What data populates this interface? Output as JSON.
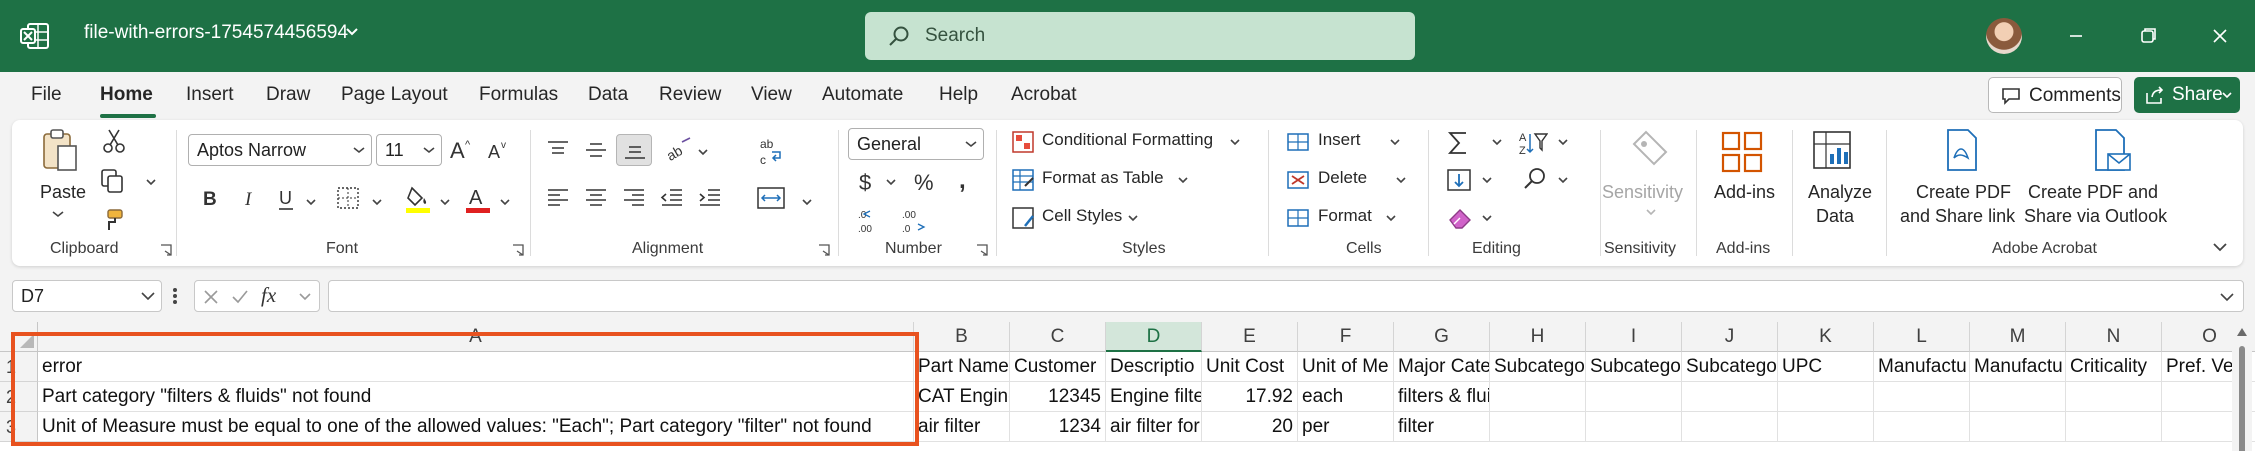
{
  "titlebar": {
    "file_name": "file-with-errors-1754574456594",
    "search_placeholder": "Search",
    "brand_color": "#1e7145"
  },
  "menu": {
    "tabs": [
      "File",
      "Home",
      "Insert",
      "Draw",
      "Page Layout",
      "Formulas",
      "Data",
      "Review",
      "View",
      "Automate",
      "Help",
      "Acrobat"
    ],
    "active_tab": "Home",
    "comments_label": "Comments",
    "share_label": "Share"
  },
  "ribbon": {
    "clipboard": {
      "label": "Clipboard",
      "paste": "Paste"
    },
    "font": {
      "label": "Font",
      "name": "Aptos Narrow",
      "size": "11"
    },
    "alignment": {
      "label": "Alignment"
    },
    "number": {
      "label": "Number",
      "format": "General"
    },
    "styles": {
      "label": "Styles",
      "conditional": "Conditional Formatting",
      "format_table": "Format as Table",
      "cell_styles": "Cell Styles"
    },
    "cells": {
      "label": "Cells",
      "insert": "Insert",
      "delete": "Delete",
      "format": "Format"
    },
    "editing": {
      "label": "Editing"
    },
    "sensitivity": {
      "label": "Sensitivity",
      "button": "Sensitivity"
    },
    "addins": {
      "label": "Add-ins",
      "button": "Add-ins"
    },
    "analyze": {
      "line1": "Analyze",
      "line2": "Data"
    },
    "acrobat": {
      "label": "Adobe Acrobat",
      "create_pdf_1": "Create PDF",
      "create_pdf_2": "and Share link",
      "create_outlook_1": "Create PDF and",
      "create_outlook_2": "Share via Outlook"
    }
  },
  "formula_bar": {
    "name_box": "D7",
    "fx": "fx",
    "value": ""
  },
  "sheet": {
    "selected_column": "D",
    "columns": [
      "A",
      "B",
      "C",
      "D",
      "E",
      "F",
      "G",
      "H",
      "I",
      "J",
      "K",
      "L",
      "M",
      "N",
      "O"
    ],
    "rows": [
      {
        "num": "1",
        "cells": [
          "error",
          "Part Name",
          "Customer",
          "Descriptio",
          "Unit Cost",
          "Unit of Me",
          "Major Cate",
          "Subcatego",
          "Subcatego",
          "Subcatego",
          "UPC",
          "Manufactu",
          "Manufactu",
          "Criticality",
          "Pref. Ve"
        ]
      },
      {
        "num": "2",
        "cells": [
          "Part category \"filters & fluids\" not found",
          "CAT Engine",
          "12345",
          "Engine filte",
          "17.92",
          "each",
          "filters & fluids",
          "",
          "",
          "",
          "",
          "",
          "",
          "",
          ""
        ]
      },
      {
        "num": "3",
        "cells": [
          "Unit of Measure must be equal to one of the allowed values: \"Each\"; Part category \"filter\" not found",
          "air filter",
          "1234",
          "air filter for",
          "20",
          "per",
          "filter",
          "",
          "",
          "",
          "",
          "",
          "",
          "",
          ""
        ]
      }
    ],
    "highlight_color": "#e8521f"
  }
}
